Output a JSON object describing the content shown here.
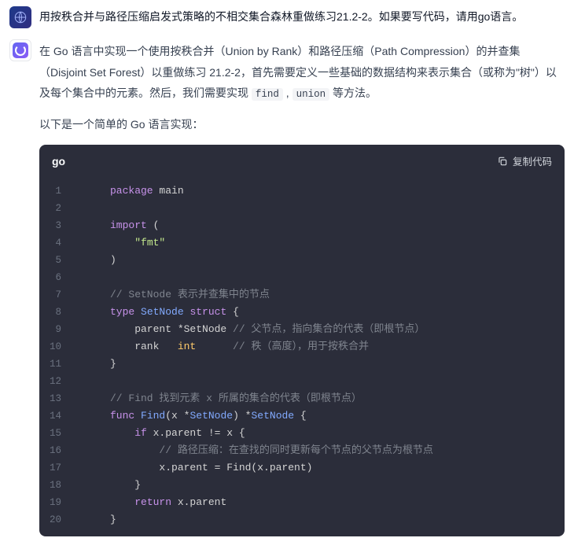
{
  "user_message": "用按秩合并与路径压缩启发式策略的不相交集合森林重做练习21.2-2。如果要写代码，请用go语言。",
  "bot_intro_parts": {
    "p1a": "在 Go 语言中实现一个使用按秩合并（Union by Rank）和路径压缩（Path Compression）的并查集（Disjoint Set Forest）以重做练习 21.2-2，首先需要定义一些基础的数据结构来表示集合（或称为\"树\"）以及每个集合中的元素。然后，我们需要实现 ",
    "code1": "find",
    "sep": " , ",
    "code2": "union",
    "p1b": " 等方法。",
    "p2": "以下是一个简单的 Go 语言实现："
  },
  "code": {
    "lang": "go",
    "copy_label": "复制代码",
    "lines": [
      {
        "n": "1",
        "seg": [
          [
            "kw",
            "package"
          ],
          [
            "plain",
            " "
          ],
          [
            "pkg",
            "main"
          ]
        ]
      },
      {
        "n": "2",
        "seg": []
      },
      {
        "n": "3",
        "seg": [
          [
            "kw",
            "import"
          ],
          [
            "plain",
            " ("
          ]
        ]
      },
      {
        "n": "4",
        "seg": [
          [
            "plain",
            "    "
          ],
          [
            "str",
            "\"fmt\""
          ]
        ]
      },
      {
        "n": "5",
        "seg": [
          [
            "plain",
            ")"
          ]
        ]
      },
      {
        "n": "6",
        "seg": []
      },
      {
        "n": "7",
        "seg": [
          [
            "cmt",
            "// SetNode 表示并查集中的节点"
          ]
        ]
      },
      {
        "n": "8",
        "seg": [
          [
            "kw",
            "type"
          ],
          [
            "plain",
            " "
          ],
          [
            "id",
            "SetNode"
          ],
          [
            "plain",
            " "
          ],
          [
            "kw",
            "struct"
          ],
          [
            "plain",
            " {"
          ]
        ]
      },
      {
        "n": "9",
        "seg": [
          [
            "plain",
            "    parent *SetNode "
          ],
          [
            "cmt",
            "// 父节点，指向集合的代表（即根节点）"
          ]
        ]
      },
      {
        "n": "10",
        "seg": [
          [
            "plain",
            "    rank   "
          ],
          [
            "builtin",
            "int"
          ],
          [
            "plain",
            "      "
          ],
          [
            "cmt",
            "// 秩（高度），用于按秩合并"
          ]
        ]
      },
      {
        "n": "11",
        "seg": [
          [
            "plain",
            "}"
          ]
        ]
      },
      {
        "n": "12",
        "seg": []
      },
      {
        "n": "13",
        "seg": [
          [
            "cmt",
            "// Find 找到元素 x 所属的集合的代表（即根节点）"
          ]
        ]
      },
      {
        "n": "14",
        "seg": [
          [
            "kw",
            "func"
          ],
          [
            "plain",
            " "
          ],
          [
            "func",
            "Find"
          ],
          [
            "plain",
            "(x *"
          ],
          [
            "id",
            "SetNode"
          ],
          [
            "plain",
            ") *"
          ],
          [
            "id",
            "SetNode"
          ],
          [
            "plain",
            " {"
          ]
        ]
      },
      {
        "n": "15",
        "seg": [
          [
            "plain",
            "    "
          ],
          [
            "kw",
            "if"
          ],
          [
            "plain",
            " x.parent != x {"
          ]
        ]
      },
      {
        "n": "16",
        "seg": [
          [
            "plain",
            "        "
          ],
          [
            "cmt",
            "// 路径压缩：在查找的同时更新每个节点的父节点为根节点"
          ]
        ]
      },
      {
        "n": "17",
        "seg": [
          [
            "plain",
            "        x.parent = Find(x.parent)"
          ]
        ]
      },
      {
        "n": "18",
        "seg": [
          [
            "plain",
            "    }"
          ]
        ]
      },
      {
        "n": "19",
        "seg": [
          [
            "plain",
            "    "
          ],
          [
            "kw",
            "return"
          ],
          [
            "plain",
            " x.parent"
          ]
        ]
      },
      {
        "n": "20",
        "seg": [
          [
            "plain",
            "}"
          ]
        ]
      }
    ]
  }
}
